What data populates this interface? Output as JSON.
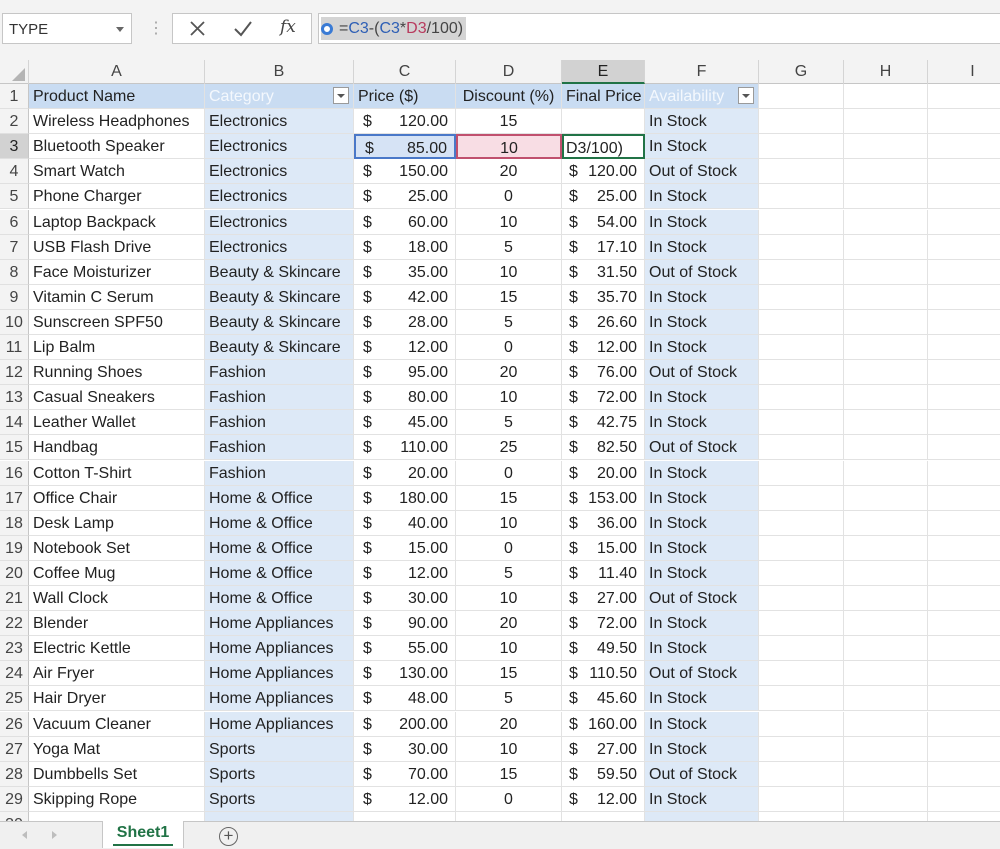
{
  "formula_bar": {
    "name_box": "TYPE",
    "formula_prefix": "=",
    "formula_ref1": "C3",
    "formula_mid": "-(",
    "formula_ref2": "C3",
    "formula_op": "*",
    "formula_ref3": "D3",
    "formula_suffix": "/100)"
  },
  "columns": [
    "A",
    "B",
    "C",
    "D",
    "E",
    "F",
    "G",
    "H",
    "I"
  ],
  "selected_column": "E",
  "selected_row": 3,
  "headers": {
    "product": "Product Name",
    "category": "Category",
    "price": "Price ($)",
    "discount": "Discount (%)",
    "final": "Final Price",
    "availability": "Availability"
  },
  "rows": [
    {
      "n": 2,
      "product": "Wireless Headphones",
      "category": "Electronics",
      "price": "120.00",
      "discount": "15",
      "final": "",
      "final_dollar": "",
      "availability": "In Stock"
    },
    {
      "n": 3,
      "product": "Bluetooth Speaker",
      "category": "Electronics",
      "price": "85.00",
      "discount": "10",
      "final": "D3/100)",
      "final_dollar": "",
      "availability": "In Stock"
    },
    {
      "n": 4,
      "product": "Smart Watch",
      "category": "Electronics",
      "price": "150.00",
      "discount": "20",
      "final": "120.00",
      "final_dollar": "$",
      "availability": "Out of Stock"
    },
    {
      "n": 5,
      "product": "Phone Charger",
      "category": "Electronics",
      "price": "25.00",
      "discount": "0",
      "final": "25.00",
      "final_dollar": "$",
      "availability": "In Stock"
    },
    {
      "n": 6,
      "product": "Laptop Backpack",
      "category": "Electronics",
      "price": "60.00",
      "discount": "10",
      "final": "54.00",
      "final_dollar": "$",
      "availability": "In Stock"
    },
    {
      "n": 7,
      "product": "USB Flash Drive",
      "category": "Electronics",
      "price": "18.00",
      "discount": "5",
      "final": "17.10",
      "final_dollar": "$",
      "availability": "In Stock"
    },
    {
      "n": 8,
      "product": "Face Moisturizer",
      "category": "Beauty & Skincare",
      "price": "35.00",
      "discount": "10",
      "final": "31.50",
      "final_dollar": "$",
      "availability": "Out of Stock"
    },
    {
      "n": 9,
      "product": "Vitamin C Serum",
      "category": "Beauty & Skincare",
      "price": "42.00",
      "discount": "15",
      "final": "35.70",
      "final_dollar": "$",
      "availability": "In Stock"
    },
    {
      "n": 10,
      "product": "Sunscreen SPF50",
      "category": "Beauty & Skincare",
      "price": "28.00",
      "discount": "5",
      "final": "26.60",
      "final_dollar": "$",
      "availability": "In Stock"
    },
    {
      "n": 11,
      "product": "Lip Balm",
      "category": "Beauty & Skincare",
      "price": "12.00",
      "discount": "0",
      "final": "12.00",
      "final_dollar": "$",
      "availability": "In Stock"
    },
    {
      "n": 12,
      "product": "Running Shoes",
      "category": "Fashion",
      "price": "95.00",
      "discount": "20",
      "final": "76.00",
      "final_dollar": "$",
      "availability": "Out of Stock"
    },
    {
      "n": 13,
      "product": "Casual Sneakers",
      "category": "Fashion",
      "price": "80.00",
      "discount": "10",
      "final": "72.00",
      "final_dollar": "$",
      "availability": "In Stock"
    },
    {
      "n": 14,
      "product": "Leather Wallet",
      "category": "Fashion",
      "price": "45.00",
      "discount": "5",
      "final": "42.75",
      "final_dollar": "$",
      "availability": "In Stock"
    },
    {
      "n": 15,
      "product": "Handbag",
      "category": "Fashion",
      "price": "110.00",
      "discount": "25",
      "final": "82.50",
      "final_dollar": "$",
      "availability": "Out of Stock"
    },
    {
      "n": 16,
      "product": "Cotton T-Shirt",
      "category": "Fashion",
      "price": "20.00",
      "discount": "0",
      "final": "20.00",
      "final_dollar": "$",
      "availability": "In Stock"
    },
    {
      "n": 17,
      "product": "Office Chair",
      "category": "Home & Office",
      "price": "180.00",
      "discount": "15",
      "final": "153.00",
      "final_dollar": "$",
      "availability": "In Stock"
    },
    {
      "n": 18,
      "product": "Desk Lamp",
      "category": "Home & Office",
      "price": "40.00",
      "discount": "10",
      "final": "36.00",
      "final_dollar": "$",
      "availability": "In Stock"
    },
    {
      "n": 19,
      "product": "Notebook Set",
      "category": "Home & Office",
      "price": "15.00",
      "discount": "0",
      "final": "15.00",
      "final_dollar": "$",
      "availability": "In Stock"
    },
    {
      "n": 20,
      "product": "Coffee Mug",
      "category": "Home & Office",
      "price": "12.00",
      "discount": "5",
      "final": "11.40",
      "final_dollar": "$",
      "availability": "In Stock"
    },
    {
      "n": 21,
      "product": "Wall Clock",
      "category": "Home & Office",
      "price": "30.00",
      "discount": "10",
      "final": "27.00",
      "final_dollar": "$",
      "availability": "Out of Stock"
    },
    {
      "n": 22,
      "product": "Blender",
      "category": "Home Appliances",
      "price": "90.00",
      "discount": "20",
      "final": "72.00",
      "final_dollar": "$",
      "availability": "In Stock"
    },
    {
      "n": 23,
      "product": "Electric Kettle",
      "category": "Home Appliances",
      "price": "55.00",
      "discount": "10",
      "final": "49.50",
      "final_dollar": "$",
      "availability": "In Stock"
    },
    {
      "n": 24,
      "product": "Air Fryer",
      "category": "Home Appliances",
      "price": "130.00",
      "discount": "15",
      "final": "110.50",
      "final_dollar": "$",
      "availability": "Out of Stock"
    },
    {
      "n": 25,
      "product": "Hair Dryer",
      "category": "Home Appliances",
      "price": "48.00",
      "discount": "5",
      "final": "45.60",
      "final_dollar": "$",
      "availability": "In Stock"
    },
    {
      "n": 26,
      "product": "Vacuum Cleaner",
      "category": "Home Appliances",
      "price": "200.00",
      "discount": "20",
      "final": "160.00",
      "final_dollar": "$",
      "availability": "In Stock"
    },
    {
      "n": 27,
      "product": "Yoga Mat",
      "category": "Sports",
      "price": "30.00",
      "discount": "10",
      "final": "27.00",
      "final_dollar": "$",
      "availability": "In Stock"
    },
    {
      "n": 28,
      "product": "Dumbbells Set",
      "category": "Sports",
      "price": "70.00",
      "discount": "15",
      "final": "59.50",
      "final_dollar": "$",
      "availability": "Out of Stock"
    },
    {
      "n": 29,
      "product": "Skipping Rope",
      "category": "Sports",
      "price": "12.00",
      "discount": "0",
      "final": "12.00",
      "final_dollar": "$",
      "availability": "In Stock"
    }
  ],
  "price_currency": "$",
  "tabs": {
    "sheet1": "Sheet1",
    "add": "+"
  },
  "colors": {
    "accent": "#217346",
    "band": "#dde9f7",
    "header_band": "#c9dcf2",
    "ref_c3": "#2e5fb5",
    "ref_d3": "#b83b5e"
  }
}
